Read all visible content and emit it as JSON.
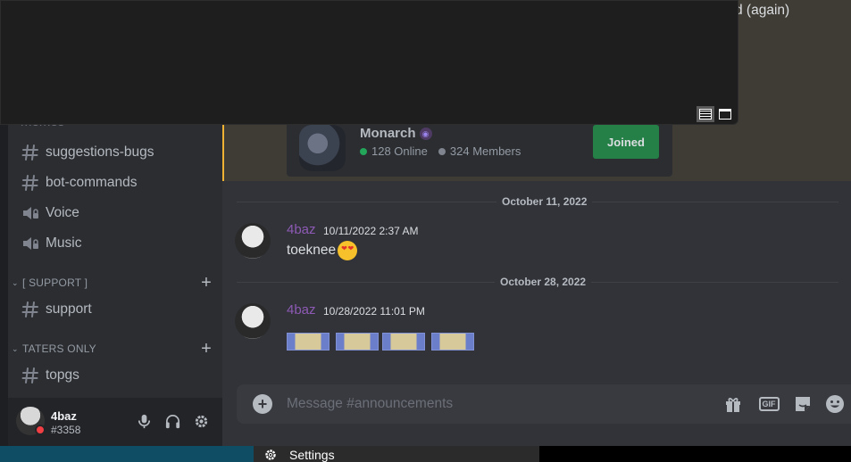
{
  "window": {
    "partial_text": "d (again)"
  },
  "sidebar": {
    "partial_channel": "memes",
    "channels": [
      {
        "label": "suggestions-bugs",
        "kind": "text"
      },
      {
        "label": "bot-commands",
        "kind": "text"
      },
      {
        "label": "Voice",
        "kind": "voice"
      },
      {
        "label": "Music",
        "kind": "voice"
      }
    ],
    "categories": [
      {
        "label": "[ SUPPORT ]",
        "channels": [
          {
            "label": "support",
            "kind": "text"
          }
        ]
      },
      {
        "label": "TATERS ONLY",
        "channels": [
          {
            "label": "topgs",
            "kind": "text"
          }
        ]
      }
    ]
  },
  "user_panel": {
    "username": "4baz",
    "discriminator": "#3358",
    "status_color": "#f23f43"
  },
  "invite": {
    "server_name": "Monarch",
    "online": "128 Online",
    "members": "324 Members",
    "join_label": "Joined",
    "online_color": "#23a55a",
    "members_color": "#80848e"
  },
  "messages": [
    {
      "date_divider": "October 11, 2022",
      "author": "4baz",
      "timestamp": "10/11/2022 2:37 AM",
      "text": "toeknee",
      "emoji": "heart-eyes-emoji"
    },
    {
      "date_divider": "October 28, 2022",
      "author": "4baz",
      "timestamp": "10/28/2022 11:01 PM",
      "text": "",
      "attachments": [
        "emote-1",
        "emote-2",
        "emote-3",
        "emote-4"
      ]
    }
  ],
  "composer": {
    "placeholder": "Message #announcements"
  },
  "taskbar": {
    "settings_label": "Settings"
  },
  "colors": {
    "accent_join": "#248046",
    "author_name": "#8e5ab5",
    "highlight_bar": "#f0b232"
  }
}
